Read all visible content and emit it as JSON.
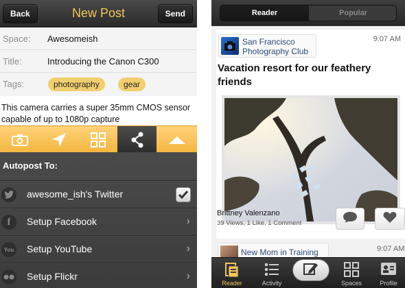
{
  "colors": {
    "accent_yellow": "#f2c658",
    "toolbar_yellow": "#f4b740",
    "tag_yellow": "#f2cf6e",
    "dark_bar": "#2a2a2a"
  },
  "compose": {
    "nav": {
      "back_label": "Back",
      "title": "New Post",
      "send_label": "Send"
    },
    "fields": {
      "space": {
        "label": "Space:",
        "value": "Awesomeish"
      },
      "title": {
        "label": "Title:",
        "value": "Introducing the Canon C300"
      },
      "tags": {
        "label": "Tags:",
        "values": [
          "photography",
          "gear"
        ]
      }
    },
    "body": "This camera carries a super 35mm CMOS sensor capable of up to 1080p capture",
    "toolbar": {
      "items": [
        "camera-icon",
        "location-icon",
        "grid-icon",
        "share-icon",
        "collapse-icon"
      ],
      "active": "share-icon"
    },
    "autopost": {
      "heading": "Autopost To:",
      "items": [
        {
          "label": "awesome_ish's Twitter",
          "icon": "twitter-icon",
          "checked": true
        },
        {
          "label": "Setup Facebook",
          "icon": "facebook-icon"
        },
        {
          "label": "Setup YouTube",
          "icon": "youtube-icon"
        },
        {
          "label": "Setup Flickr",
          "icon": "flickr-icon"
        }
      ]
    }
  },
  "reader": {
    "segments": {
      "reader": "Reader",
      "popular": "Popular",
      "active": "Reader"
    },
    "post": {
      "space": "San Francisco Photography Club",
      "time": "9:07 AM",
      "title": "Vacation resort for our feathery friends",
      "author": "Brittney Valenzano",
      "stats": "39 Views, 1 Like, 1 Comment"
    },
    "next_post": {
      "space": "New Mom in Training",
      "time": "9:07 AM"
    },
    "tabs": {
      "reader": "Reader",
      "activity": "Activity",
      "spaces": "Spaces",
      "profile": "Profile",
      "active": "Reader"
    }
  }
}
